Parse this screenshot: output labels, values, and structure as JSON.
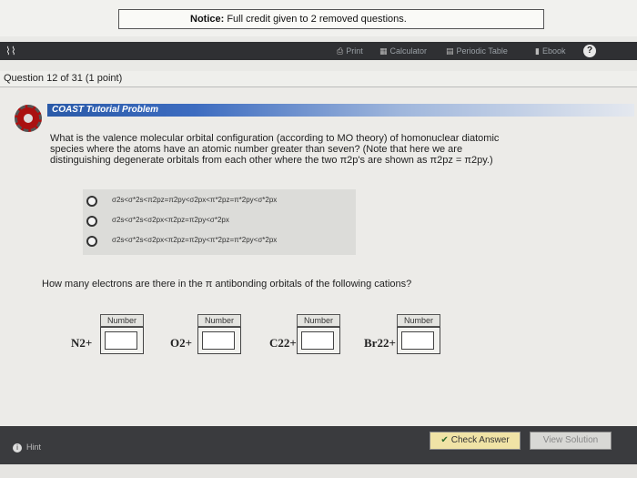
{
  "notice": {
    "label": "Notice:",
    "message": " Full credit given to 2 removed questions."
  },
  "toolbar": {
    "print": "Print",
    "calculator": "Calculator",
    "periodic_table": "Periodic Table",
    "ebook": "Ebook",
    "help": "?"
  },
  "question": {
    "title": "Question 12 of 31 (1 point)"
  },
  "banner": {
    "label": "COAST Tutorial Problem"
  },
  "prompt": {
    "line1": "What is the valence molecular orbital configuration (according to MO theory) of homonuclear diatomic",
    "line2": "species where the atoms have an atomic number greater than seven? (Note that here we are",
    "line3": "distinguishing degenerate orbitals from each other where the two π2p's are shown as π2pz = π2py.)"
  },
  "choices": [
    "σ2s<σ*2s<π2pz=π2py<σ2px<π*2pz=π*2py<σ*2px",
    "σ2s<σ*2s<σ2px<π2pz=π2py<σ*2px",
    "σ2s<σ*2s<σ2px<π2pz=π2py<π*2pz=π*2py<σ*2px"
  ],
  "question2": "How many electrons are there in the π antibonding orbitals of the following cations?",
  "inputs": [
    {
      "species": "N2+",
      "label": "Number",
      "value": ""
    },
    {
      "species": "O2+",
      "label": "Number",
      "value": ""
    },
    {
      "species": "C22+",
      "label": "Number",
      "value": ""
    },
    {
      "species": "Br22+",
      "label": "Number",
      "value": ""
    }
  ],
  "bottom": {
    "hint": "Hint",
    "check": "Check Answer",
    "view": "View Solution"
  }
}
